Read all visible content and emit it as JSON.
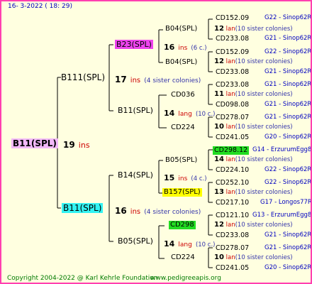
{
  "header": {
    "date": "16-  3-2022 ( 18: 29)"
  },
  "root": {
    "name": "B11(SPL)",
    "count": "19",
    "unit": "ins",
    "bg": "#f2b8f8"
  },
  "level1": [
    {
      "name": "B111(SPL)",
      "count": "17",
      "unit": "ins",
      "note": "(4 sister colonies)",
      "bg": ""
    },
    {
      "name": "B11(SPL)",
      "count": "16",
      "unit": "ins",
      "note": "(4 sister colonies)",
      "bg": "#33f3f3"
    }
  ],
  "level2": [
    {
      "name": "B23(SPL)",
      "count": "16",
      "unit": "ins",
      "note": "(6 c.)",
      "bg": "#ee44ee"
    },
    {
      "name": "B11(SPL)",
      "count": "14",
      "unit": "lang",
      "note": "(10 c.)",
      "bg": ""
    },
    {
      "name": "B14(SPL)",
      "count": "15",
      "unit": "ins",
      "note": "(4 c.)",
      "bg": ""
    },
    {
      "name": "B05(SPL)",
      "count": "14",
      "unit": "lang",
      "note": "(10 c.)",
      "bg": ""
    }
  ],
  "level3": [
    {
      "name": "B04(SPL)",
      "count": "12",
      "unit": "lan",
      "note": "(10 sister colonies)",
      "bg": ""
    },
    {
      "name": "B04(SPL)",
      "count": "12",
      "unit": "lan",
      "note": "(10 sister colonies)",
      "bg": ""
    },
    {
      "name": "CD036",
      "count": "11",
      "unit": "lan",
      "note": "(10 sister colonies)",
      "bg": ""
    },
    {
      "name": "CD224",
      "count": "10",
      "unit": "lan",
      "note": "(10 sister colonies)",
      "bg": ""
    },
    {
      "name": "B05(SPL)",
      "count": "14",
      "unit": "lan",
      "note": "(10 sister colonies)",
      "bg": ""
    },
    {
      "name": "B157(SPL)",
      "count": "13",
      "unit": "lan",
      "note": "(10 sister colonies)",
      "bg": "#ffff00"
    },
    {
      "name": "CD298",
      "count": "12",
      "unit": "lan",
      "note": "(10 sister colonies)",
      "bg": "#22dd22"
    },
    {
      "name": "CD224",
      "count": "10",
      "unit": "lan",
      "note": "(10 sister colonies)",
      "bg": ""
    }
  ],
  "level4": [
    {
      "name": "CD152.09",
      "place": "G22 - Sinop62R",
      "bg": ""
    },
    {
      "name": "CD233.08",
      "place": "G21 - Sinop62R",
      "bg": ""
    },
    {
      "name": "CD152.09",
      "place": "G22 - Sinop62R",
      "bg": ""
    },
    {
      "name": "CD233.08",
      "place": "G21 - Sinop62R",
      "bg": ""
    },
    {
      "name": "CD233.08",
      "place": "G21 - Sinop62R",
      "bg": ""
    },
    {
      "name": "CD098.08",
      "place": "G21 - Sinop62R",
      "bg": ""
    },
    {
      "name": "CD278.07",
      "place": "G21 - Sinop62R",
      "bg": ""
    },
    {
      "name": "CD241.05",
      "place": "G20 - Sinop62R",
      "bg": ""
    },
    {
      "name": "CD298.12",
      "place": "G14 - ErzurumEgg8",
      "bg": "#22dd22"
    },
    {
      "name": "CD224.10",
      "place": "G22 - Sinop62R",
      "bg": ""
    },
    {
      "name": "CD252.10",
      "place": "G22 - Sinop62R",
      "bg": ""
    },
    {
      "name": "CD217.10",
      "place": "G17 - Longos77R",
      "bg": ""
    },
    {
      "name": "CD121.10",
      "place": "G13 - ErzurumEgg8",
      "bg": ""
    },
    {
      "name": "CD233.08",
      "place": "G21 - Sinop62R",
      "bg": ""
    },
    {
      "name": "CD278.07",
      "place": "G21 - Sinop62R",
      "bg": ""
    },
    {
      "name": "CD241.05",
      "place": "G20 - Sinop62R",
      "bg": ""
    }
  ],
  "footer": {
    "copyright": "Copyright 2004-2022 @ Karl Kehrle Foundation",
    "url": "www.pedigreeapis.org"
  }
}
